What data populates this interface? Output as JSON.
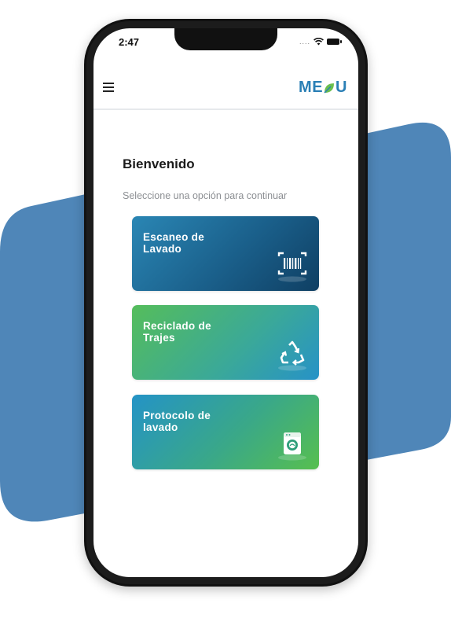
{
  "status_bar": {
    "time": "2:47",
    "signal": "....",
    "icons": [
      "wifi-icon",
      "battery-icon"
    ]
  },
  "app_bar": {
    "menu_icon": "hamburger-menu-icon",
    "logo_text_left": "ME",
    "logo_text_right": "U"
  },
  "main": {
    "title": "Bienvenido",
    "subtitle": "Seleccione una opción para continuar",
    "options": [
      {
        "label": "Escaneo de Lavado",
        "icon": "barcode-scan-icon"
      },
      {
        "label": "Reciclado de Trajes",
        "icon": "recycle-icon"
      },
      {
        "label": "Protocolo de lavado",
        "icon": "washing-machine-icon"
      }
    ]
  },
  "colors": {
    "brand_blue": "#2a7fb5",
    "background_blob": "#4f86b8",
    "card_blue_dark": "#0f3f63",
    "card_green": "#55bd5b"
  }
}
